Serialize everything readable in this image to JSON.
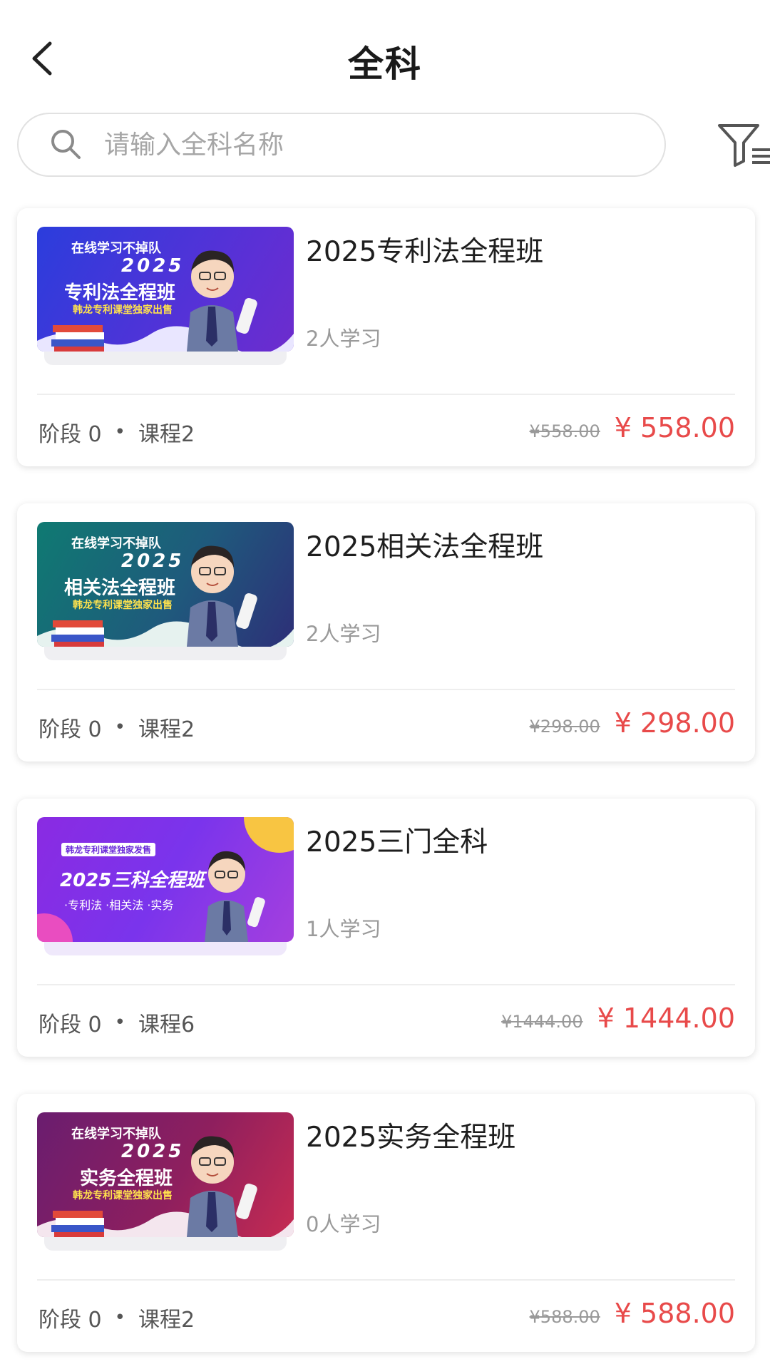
{
  "header": {
    "title": "全科"
  },
  "search": {
    "placeholder": "请输入全科名称"
  },
  "courses": [
    {
      "title": "2025专利法全程班",
      "learners": "2人学习",
      "stage": "阶段 0",
      "lessons": "课程2",
      "old_price": "¥558.00",
      "price": "¥ 558.00",
      "thumb": {
        "line1": "在线学习不掉队",
        "line2": "2025",
        "line3": "专利法全程班",
        "line4": "韩龙专利课堂独家出售"
      },
      "colors": {
        "bg1": "#2f3bd6",
        "bg2": "#6e2fd0"
      }
    },
    {
      "title": "2025相关法全程班",
      "learners": "2人学习",
      "stage": "阶段 0",
      "lessons": "课程2",
      "old_price": "¥298.00",
      "price": "¥ 298.00",
      "thumb": {
        "line1": "在线学习不掉队",
        "line2": "2025",
        "line3": "相关法全程班",
        "line4": "韩龙专利课堂独家出售"
      },
      "colors": {
        "bg1": "#0c6f73",
        "bg2": "#2a2f7e"
      }
    },
    {
      "title": "2025三门全科",
      "learners": "1人学习",
      "stage": "阶段 0",
      "lessons": "课程6",
      "old_price": "¥1444.00",
      "price": "¥ 1444.00",
      "thumb": {
        "line1": "韩龙专利课堂独家发售",
        "line2": "2025三科全程班",
        "line3": "·专利法 ·相关法 ·实务"
      },
      "colors": {
        "bg1": "#7b2ff0",
        "bg2": "#b13fe0"
      }
    },
    {
      "title": "2025实务全程班",
      "learners": "0人学习",
      "stage": "阶段 0",
      "lessons": "课程2",
      "old_price": "¥588.00",
      "price": "¥ 588.00",
      "thumb": {
        "line1": "在线学习不掉队",
        "line2": "2025",
        "line3": "实务全程班",
        "line4": "韩龙专利课堂独家出售"
      },
      "colors": {
        "bg1": "#7a1e6e",
        "bg2": "#c02a5a"
      }
    }
  ]
}
